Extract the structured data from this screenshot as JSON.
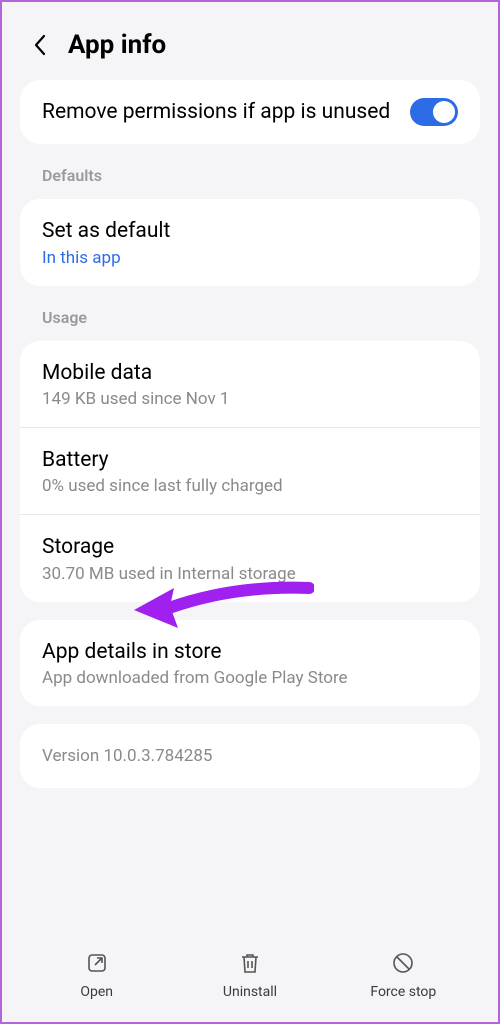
{
  "header": {
    "title": "App info"
  },
  "permissions_card": {
    "title": "Remove permissions if app is unused",
    "toggle_on": true
  },
  "sections": {
    "defaults_label": "Defaults",
    "usage_label": "Usage"
  },
  "defaults_card": {
    "title": "Set as default",
    "subtitle": "In this app"
  },
  "usage_card": {
    "mobile_data": {
      "title": "Mobile data",
      "subtitle": "149 KB used since Nov 1"
    },
    "battery": {
      "title": "Battery",
      "subtitle": "0% used since last fully charged"
    },
    "storage": {
      "title": "Storage",
      "subtitle": "30.70 MB used in Internal storage"
    }
  },
  "store_card": {
    "title": "App details in store",
    "subtitle": "App downloaded from Google Play Store"
  },
  "version_card": {
    "text": "Version 10.0.3.784285"
  },
  "bottom_nav": {
    "open_label": "Open",
    "uninstall_label": "Uninstall",
    "force_stop_label": "Force stop"
  },
  "colors": {
    "accent": "#2e6be6",
    "annotation": "#a020f0"
  }
}
